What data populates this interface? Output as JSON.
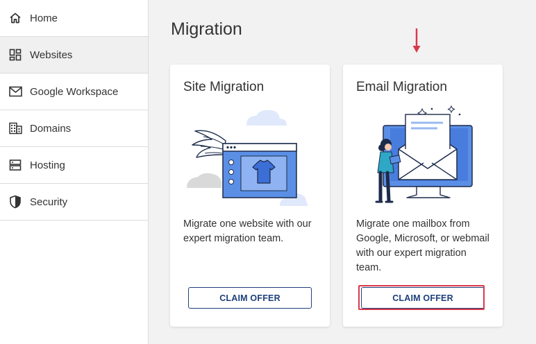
{
  "sidebar": {
    "items": [
      {
        "label": "Home",
        "icon": "home-icon"
      },
      {
        "label": "Websites",
        "icon": "dashboard-icon",
        "active": true
      },
      {
        "label": "Google Workspace",
        "icon": "mail-icon"
      },
      {
        "label": "Domains",
        "icon": "building-icon"
      },
      {
        "label": "Hosting",
        "icon": "server-icon"
      },
      {
        "label": "Security",
        "icon": "shield-icon"
      }
    ]
  },
  "main": {
    "title": "Migration",
    "cards": [
      {
        "title": "Site Migration",
        "description": "Migrate one website with our expert migration team.",
        "button": "CLAIM OFFER"
      },
      {
        "title": "Email Migration",
        "description": "Migrate one mailbox from Google, Microsoft, or webmail with our expert migration team.",
        "button": "CLAIM OFFER"
      }
    ]
  },
  "colors": {
    "accent": "#1d3f7a",
    "highlight": "#d9394a",
    "illustration_blue": "#5b8fe6"
  }
}
